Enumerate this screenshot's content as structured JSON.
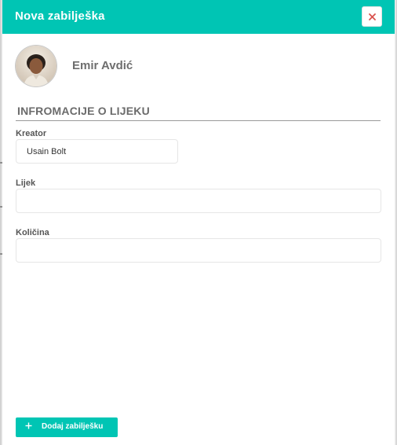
{
  "modal": {
    "title": "Nova zabilješka",
    "close_icon": "close-icon",
    "colors": {
      "accent": "#00c5b4",
      "close_icon": "#d9534f"
    }
  },
  "user": {
    "name": "Emir Avdić",
    "avatar_icon": "avatar"
  },
  "section": {
    "title": "INFROMACIJE O LIJEKU"
  },
  "form": {
    "creator": {
      "label": "Kreator",
      "value": "Usain Bolt"
    },
    "medicine": {
      "label": "Lijek",
      "value": ""
    },
    "quantity": {
      "label": "Količina",
      "value": ""
    }
  },
  "footer": {
    "add_button_icon": "plus-icon",
    "add_button_label": "Dodaj zabilješku"
  }
}
